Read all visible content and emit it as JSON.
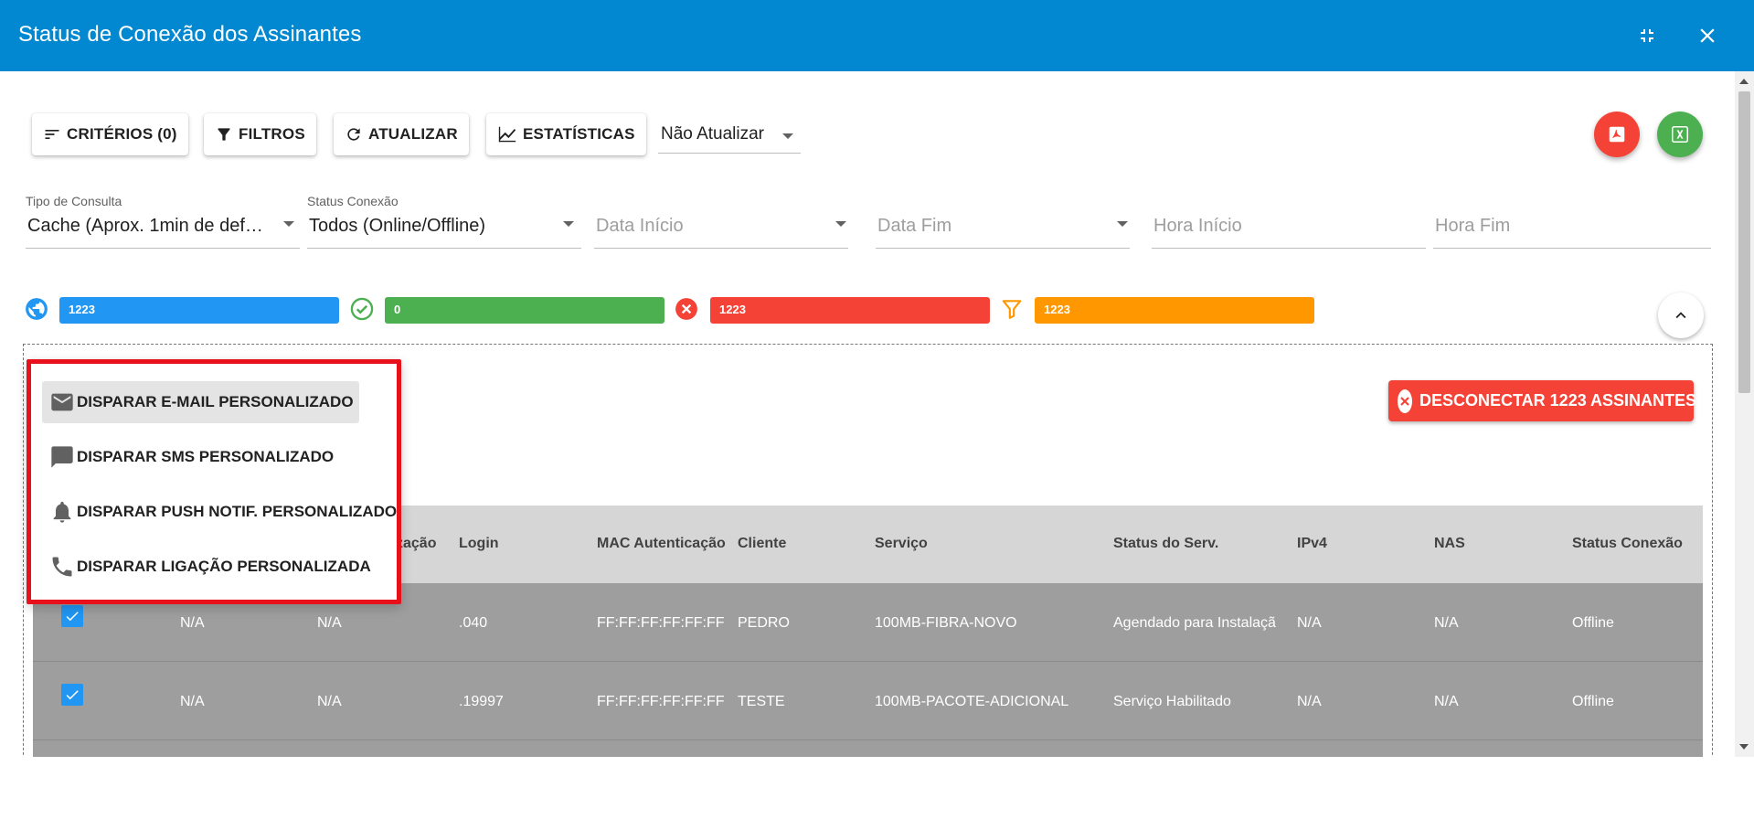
{
  "window": {
    "title": "Status de Conexão dos Assinantes",
    "shrink_icon": "fullscreen-exit-icon",
    "close_icon": "close-icon"
  },
  "toolbar": {
    "criterios_label": "CRITÉRIOS (0)",
    "filtros_label": "FILTROS",
    "atualizar_label": "ATUALIZAR",
    "estatisticas_label": "ESTATÍSTICAS",
    "refresh_select_value": "Não Atualizar",
    "pdf_icon": "pdf-icon",
    "excel_icon": "excel-icon",
    "pdf_color": "#f44336",
    "excel_color": "#4caf50"
  },
  "filters": {
    "tipo_consulta": {
      "label": "Tipo de Consulta",
      "value": "Cache (Aprox. 1min de defa..."
    },
    "status_conexao": {
      "label": "Status Conexão",
      "value": "Todos (Online/Offline)"
    },
    "data_inicio": {
      "placeholder": "Data Início"
    },
    "data_fim": {
      "placeholder": "Data Fim"
    },
    "hora_inicio": {
      "placeholder": "Hora Início"
    },
    "hora_fim": {
      "placeholder": "Hora Fim"
    }
  },
  "stats": {
    "total": {
      "value": "1223",
      "color": "#2196f3",
      "icon": "globe-icon"
    },
    "online": {
      "value": "0",
      "color": "#4caf50",
      "icon": "check-circle-icon"
    },
    "offline": {
      "value": "1223",
      "color": "#f44336",
      "icon": "cancel-circle-icon"
    },
    "filtered": {
      "value": "1223",
      "color": "#ff9800",
      "icon": "filter-icon"
    }
  },
  "actions": {
    "disconnect_label": "DESCONECTAR 1223 ASSINANTES!",
    "disconnect_color": "#f44336"
  },
  "context_menu": {
    "items": [
      {
        "label": "DISPARAR E-MAIL PERSONALIZADO",
        "icon": "email-icon"
      },
      {
        "label": "DISPARAR SMS PERSONALIZADO",
        "icon": "sms-icon"
      },
      {
        "label": "DISPARAR PUSH NOTIF. PERSONALIZADO",
        "icon": "bell-icon"
      },
      {
        "label": "DISPARAR LIGAÇÃO PERSONALIZADA",
        "icon": "phone-icon"
      }
    ]
  },
  "table": {
    "columns": [
      "zação",
      "Login",
      "MAC Autenticação",
      "Cliente",
      "Serviço",
      "Status do Serv.",
      "IPv4",
      "NAS",
      "Status Conexão"
    ],
    "rows": [
      {
        "col1": "N/A",
        "col2": "N/A",
        "login": ".040",
        "mac": "FF:FF:FF:FF:FF:FF",
        "cliente": "PEDRO",
        "servico": "100MB-FIBRA-NOVO",
        "status_serv": "Agendado para Instalaçã",
        "ipv4": "N/A",
        "nas": "N/A",
        "status_conexao": "Offline"
      },
      {
        "col1": "N/A",
        "col2": "N/A",
        "login": ".19997",
        "mac": "FF:FF:FF:FF:FF:FF",
        "cliente": "TESTE",
        "servico": "100MB-PACOTE-ADICIONAL",
        "status_serv": "Serviço Habilitado",
        "ipv4": "N/A",
        "nas": "N/A",
        "status_conexao": "Offline"
      }
    ]
  }
}
